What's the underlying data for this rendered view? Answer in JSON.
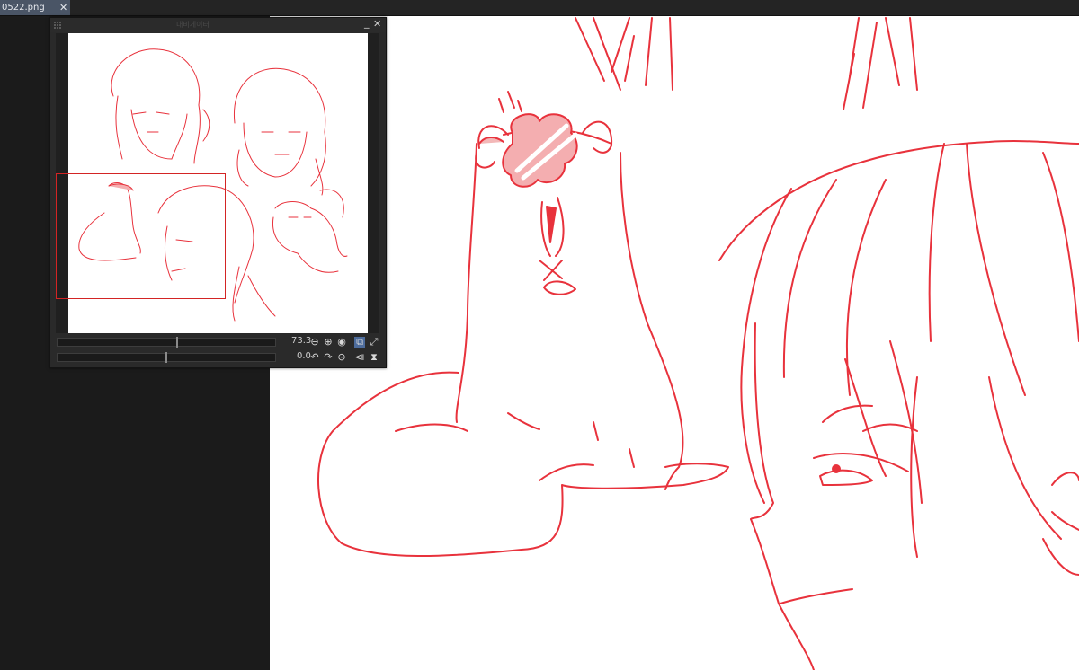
{
  "tab": {
    "filename": "0522.png",
    "close_glyph": "✕"
  },
  "navigator": {
    "title": "내비게이터",
    "minimize_glyph": "_",
    "close_glyph": "✕",
    "zoom_value": "73.3",
    "rotation_value": "0.0",
    "zoom_buttons": [
      "zoom-out-icon",
      "zoom-in-icon",
      "fit-stop-icon",
      "fit-window-icon",
      "fullscreen-icon"
    ],
    "rotate_buttons": [
      "rotate-left-icon",
      "rotate-right-icon",
      "reset-rotation-icon",
      "flip-horizontal-icon",
      "flip-vertical-icon"
    ]
  },
  "colors": {
    "line_art": "#e8323c",
    "accent": "#4d6c9c",
    "frame": "#d32424"
  }
}
